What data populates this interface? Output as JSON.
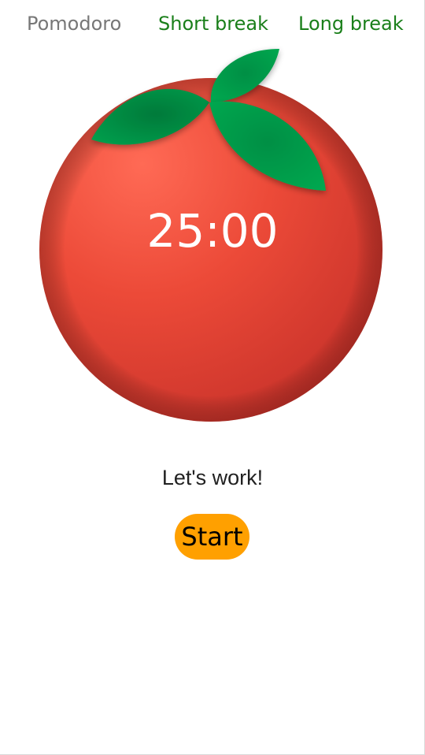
{
  "tabs": [
    {
      "label": "Pomodoro",
      "color": "#777777",
      "active": true
    },
    {
      "label": "Short break",
      "color": "#1a7f1a",
      "active": false
    },
    {
      "label": "Long break",
      "color": "#1a7f1a",
      "active": false
    }
  ],
  "timer": {
    "display": "25:00"
  },
  "status": {
    "message": "Let's work!"
  },
  "start_button": {
    "label": "Start",
    "color": "#ffa000"
  },
  "tomato": {
    "body_color": "#e8493a",
    "leaf_color": "#00a14b",
    "icon": "tomato-icon"
  }
}
